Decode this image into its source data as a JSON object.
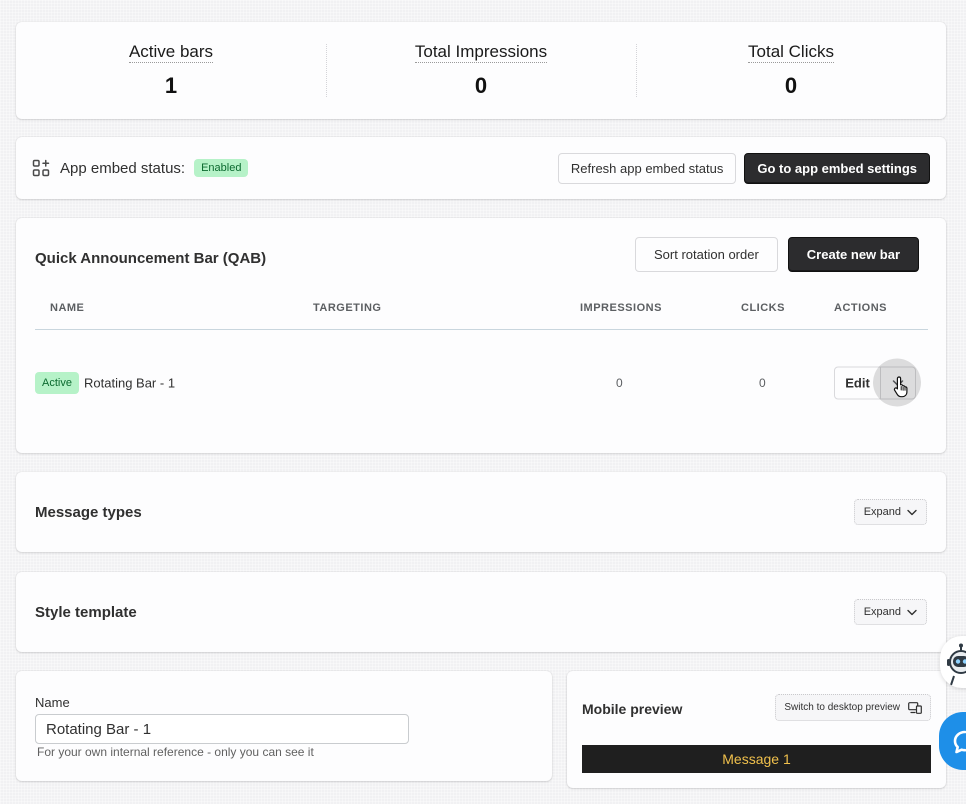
{
  "stats": [
    {
      "label": "Active bars",
      "value": "1"
    },
    {
      "label": "Total Impressions",
      "value": "0"
    },
    {
      "label": "Total Clicks",
      "value": "0"
    }
  ],
  "embed": {
    "label": "App embed status:",
    "badge": "Enabled",
    "refresh_label": "Refresh app embed status",
    "settings_label": "Go to app embed settings"
  },
  "qab": {
    "title": "Quick Announcement Bar (QAB)",
    "sort_label": "Sort rotation order",
    "create_label": "Create new bar",
    "columns": [
      "NAME",
      "TARGETING",
      "IMPRESSIONS",
      "CLICKS",
      "ACTIONS"
    ],
    "rows": [
      {
        "status": "Active",
        "name": "Rotating Bar - 1",
        "impressions": "0",
        "clicks": "0",
        "edit_label": "Edit"
      }
    ]
  },
  "message_types": {
    "title": "Message types",
    "expand_label": "Expand"
  },
  "style_template": {
    "title": "Style template",
    "expand_label": "Expand"
  },
  "name_field": {
    "label": "Name",
    "value": "Rotating Bar - 1",
    "help": "For your own internal reference - only you can see it"
  },
  "preview": {
    "title": "Mobile preview",
    "switch_label": "Switch to desktop preview",
    "message": "Message 1"
  },
  "colors": {
    "accent_dark": "#2c2c2e",
    "success_bg": "#b6f2c8",
    "message_text": "#f0c04c",
    "chat_button": "#1e8fe8"
  }
}
